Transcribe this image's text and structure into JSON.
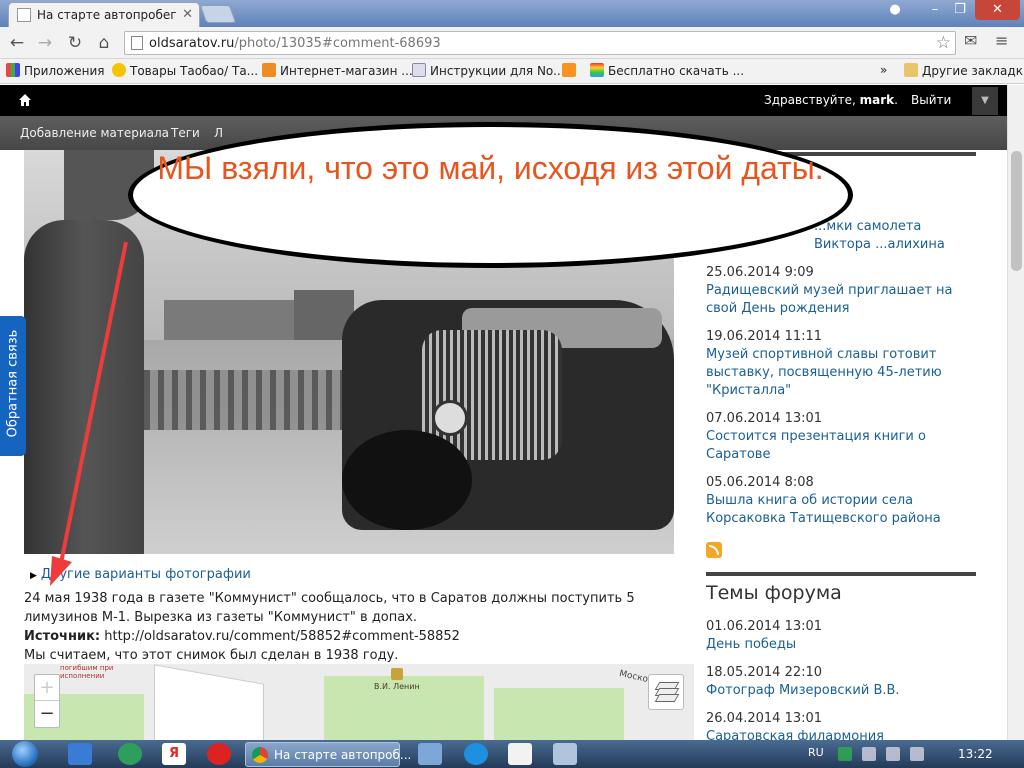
{
  "browser": {
    "tab_title": "На старте автопробега. |",
    "url_host": "oldsaratov.ru",
    "url_path": "/photo/13035#comment-68693",
    "bookmarks": [
      {
        "label": "Приложения"
      },
      {
        "label": "Товары Таобао/ Та..."
      },
      {
        "label": "Интернет-магазин ..."
      },
      {
        "label": "Инструкции для No..."
      },
      {
        "label": ""
      },
      {
        "label": "Бесплатно скачать ..."
      }
    ],
    "bookmarks_more": "»",
    "other_bookmarks": "Другие закладки"
  },
  "site": {
    "greeting": "Здравствуйте,",
    "username": "mark",
    "logout": "Выйти",
    "nav": [
      "Добавление материала",
      "Теги",
      "Л"
    ]
  },
  "content": {
    "other_variants": "Другие варианты фотографии",
    "caption_line1": "24 мая 1938 года в газете \"Коммунист\" сообщалось, что в Саратов должны поступить 5 лимузинов М-1. Вырезка из газеты \"Коммунист\" в допах.",
    "source_label": "Источник:",
    "source_value": "http://oldsaratov.ru/comment/58852#comment-58852",
    "caption_line3": "Мы считаем, что этот снимок был сделан в 1938 году."
  },
  "map": {
    "poi": "В.И. Ленин",
    "street": "Моско",
    "corner_label": "погибшим при исполнении",
    "zoom_in": "+",
    "zoom_out": "−"
  },
  "sidebar": {
    "news": [
      {
        "date": "",
        "title": "...мки самолета Виктора ...алихина"
      },
      {
        "date": "25.06.2014 9:09",
        "title": "Радищевский музей приглашает на свой День рождения"
      },
      {
        "date": "19.06.2014 11:11",
        "title": "Музей спортивной славы готовит выставку, посвященную 45-летию \"Кристалла\""
      },
      {
        "date": "07.06.2014 13:01",
        "title": "Состоится презентация книги о Саратове"
      },
      {
        "date": "05.06.2014 8:08",
        "title": "Вышла книга об истории села Корсаковка Татищевского района"
      }
    ],
    "forum_title": "Темы форума",
    "forum": [
      {
        "date": "01.06.2014 13:01",
        "title": "День победы"
      },
      {
        "date": "18.05.2014 22:10",
        "title": "Фотограф Мизеровский В.В."
      },
      {
        "date": "26.04.2014 13:01",
        "title": "Саратовская филармония"
      }
    ]
  },
  "feedback_tab": "Обратная связь",
  "annotation": {
    "text": "МЫ взяли, что это май, исходя из этой даты.",
    "color": "#e8541d"
  },
  "taskbar": {
    "active_task": "На старте автопроб...",
    "language": "RU",
    "clock": "13:22"
  }
}
